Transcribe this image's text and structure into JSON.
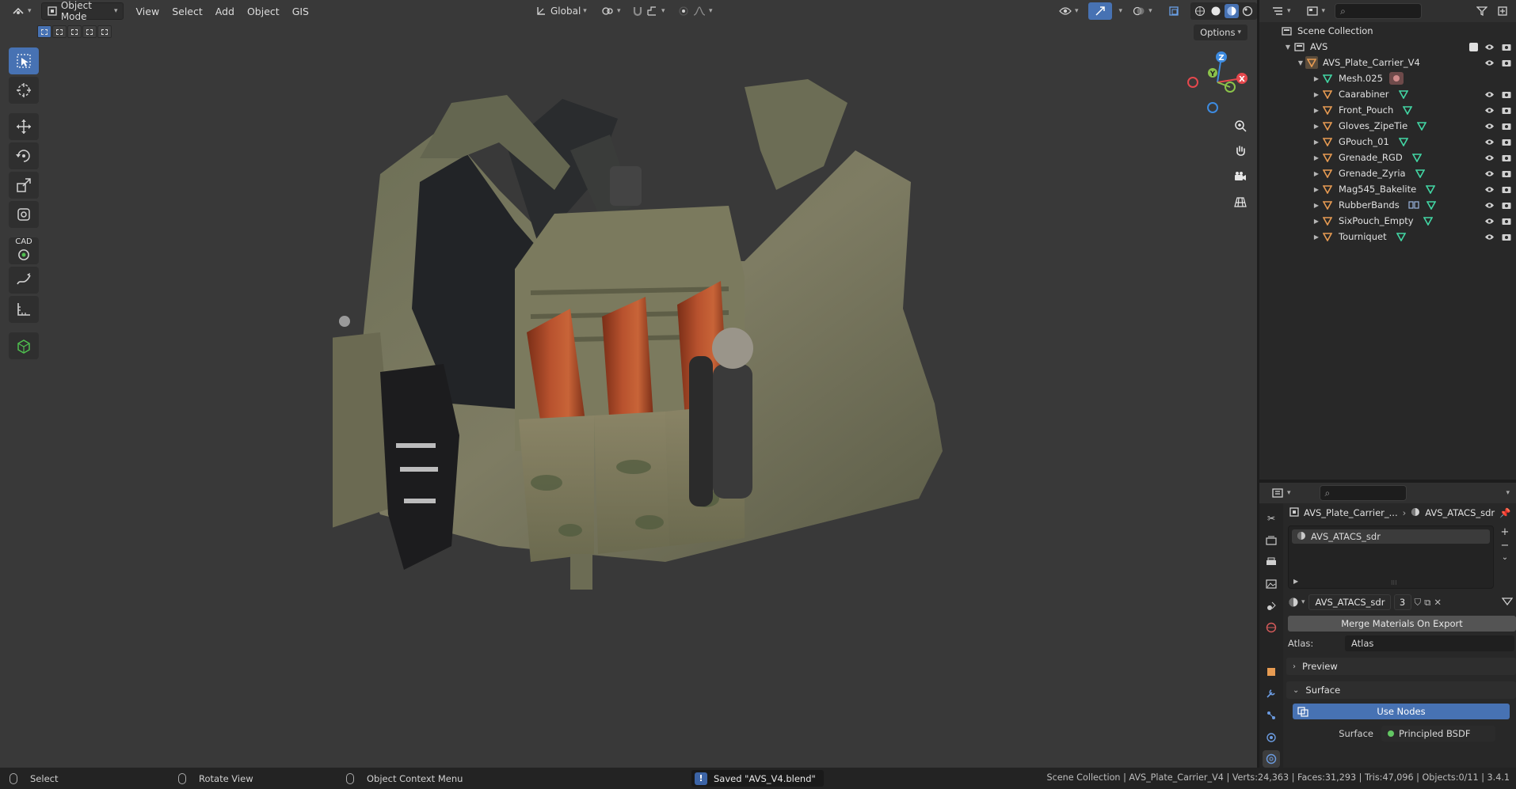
{
  "header": {
    "mode": "Object Mode",
    "menus": [
      "View",
      "Select",
      "Add",
      "Object",
      "GIS"
    ],
    "orientation": "Global",
    "options_label": "Options"
  },
  "toolbar": {
    "tools": [
      "select-box-icon",
      "cursor-icon",
      "move-icon",
      "rotate-icon",
      "scale-icon",
      "transform-icon",
      "cad-icon",
      "annotate-icon",
      "measure-icon",
      "add-cube-icon"
    ],
    "cad_label": "CAD"
  },
  "gizmo": {
    "z": "Z",
    "y": "Y",
    "x": "X"
  },
  "outliner": {
    "root": "Scene Collection",
    "collection": "AVS",
    "parent": "AVS_Plate_Carrier_V4",
    "children": [
      "Mesh.025",
      "Caarabiner",
      "Front_Pouch",
      "Gloves_ZipeTie",
      "GPouch_01",
      "Grenade_RGD",
      "Grenade_Zyria",
      "Mag545_Bakelite",
      "RubberBands",
      "SixPouch_Empty",
      "Tourniquet"
    ]
  },
  "properties": {
    "breadcrumb_object": "AVS_Plate_Carrier_...",
    "breadcrumb_material": "AVS_ATACS_sdr",
    "slot_name": "AVS_ATACS_sdr",
    "material_name": "AVS_ATACS_sdr",
    "user_count": "3",
    "merge_button": "Merge Materials On Export",
    "atlas_label": "Atlas:",
    "atlas_value": "Atlas",
    "preview_label": "Preview",
    "surface_label": "Surface",
    "use_nodes": "Use Nodes",
    "surface_field_label": "Surface",
    "surface_value": "Principled BSDF"
  },
  "statusbar": {
    "select": "Select",
    "rotate": "Rotate View",
    "context": "Object Context Menu",
    "saved": "Saved \"AVS_V4.blend\"",
    "stats": "Scene Collection | AVS_Plate_Carrier_V4 | Verts:24,363 | Faces:31,293 | Tris:47,096 | Objects:0/11 | 3.4.1"
  },
  "colors": {
    "accent": "#4772b3",
    "viewport_bg": "#393939",
    "panel_bg": "#282828",
    "mesh_icon": "#42d6a4",
    "object_icon": "#e79b52",
    "axis_x": "#e5484d",
    "axis_y": "#8bc34a",
    "axis_z": "#3d8be0"
  }
}
